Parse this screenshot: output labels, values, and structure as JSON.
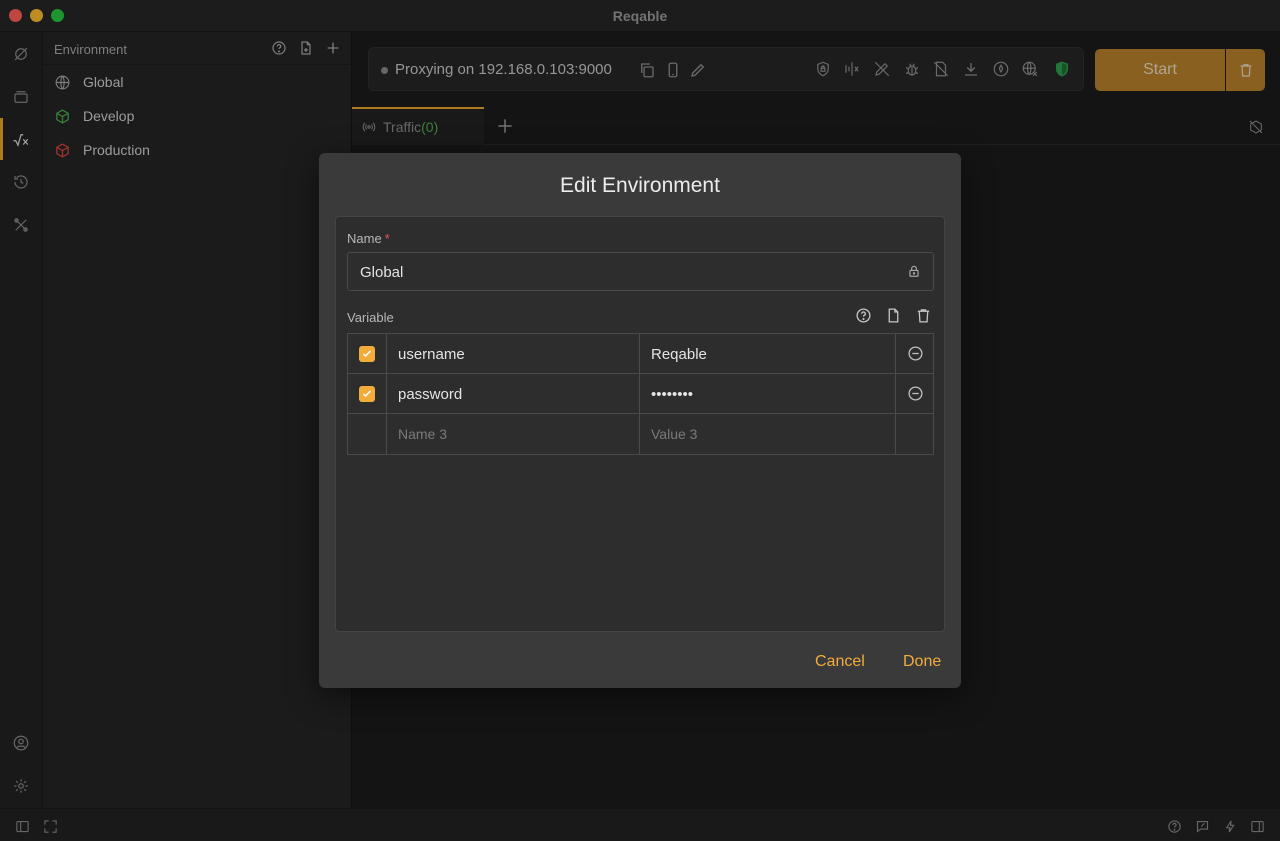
{
  "app": {
    "title": "Reqable"
  },
  "activity": {
    "icons": [
      "capture-icon",
      "collections-icon",
      "environment-icon",
      "history-icon",
      "tools-icon",
      "account-icon",
      "settings-icon"
    ]
  },
  "sidebar": {
    "title": "Environment",
    "items": [
      {
        "label": "Global",
        "icon": "globe-icon"
      },
      {
        "label": "Develop",
        "icon": "cube-icon",
        "color": "#4cae4c"
      },
      {
        "label": "Production",
        "icon": "cube-icon",
        "color": "#d9443c"
      }
    ]
  },
  "proxy": {
    "status": "Proxying on 192.168.0.103:9000",
    "start_label": "Start"
  },
  "tabs": [
    {
      "label": "Traffic",
      "count": "(0)"
    }
  ],
  "dialog": {
    "title": "Edit Environment",
    "name_label": "Name",
    "required_mark": "*",
    "name_value": "Global",
    "variable_label": "Variable",
    "variables": [
      {
        "enabled": true,
        "name": "username",
        "value": "Reqable"
      },
      {
        "enabled": true,
        "name": "password",
        "value": "••••••••"
      }
    ],
    "new_row": {
      "name_placeholder": "Name 3",
      "value_placeholder": "Value 3"
    },
    "cancel_label": "Cancel",
    "done_label": "Done"
  },
  "colors": {
    "accent": "#f2ac3c",
    "start_button": "#b7812a",
    "develop": "#4cae4c",
    "production": "#d9443c",
    "shield": "#2e9e4a"
  }
}
